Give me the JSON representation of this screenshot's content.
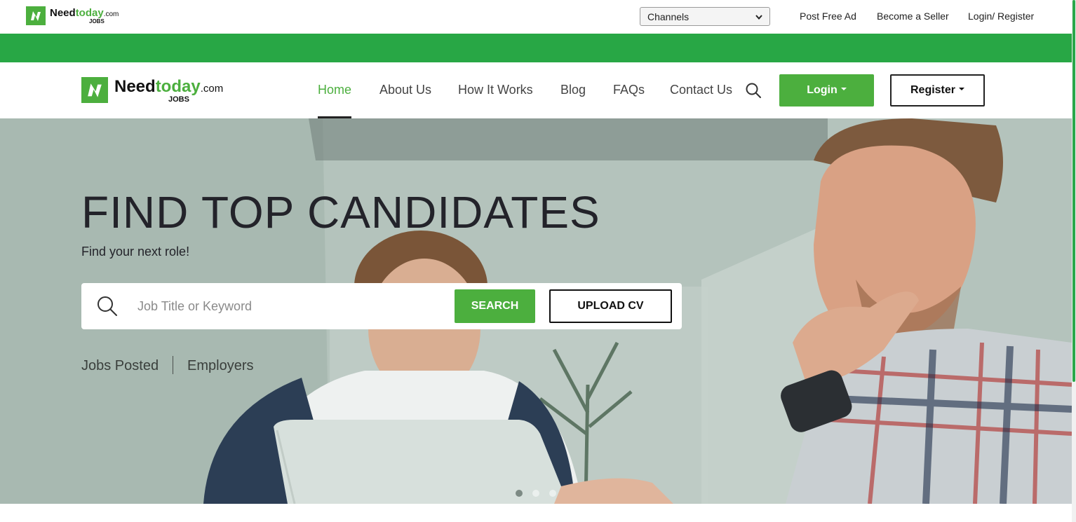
{
  "topbar": {
    "logo": {
      "need": "Need",
      "today": "today",
      "dotcom": ".com",
      "jobs": "JOBS"
    },
    "channels_select": {
      "value": "Channels",
      "icon": "chevron-down-icon"
    },
    "links": [
      "Post Free Ad",
      "Become a Seller",
      "Login/ Register"
    ]
  },
  "navbar": {
    "logo": {
      "need": "Need",
      "today": "today",
      "dotcom": ".com",
      "jobs": "JOBS"
    },
    "items": [
      {
        "label": "Home",
        "active": true
      },
      {
        "label": "About Us"
      },
      {
        "label": "How It Works"
      },
      {
        "label": "Blog"
      },
      {
        "label": "FAQs"
      },
      {
        "label": "Contact Us"
      }
    ],
    "search_icon": "search-icon",
    "login_label": "Login",
    "register_label": "Register"
  },
  "hero": {
    "title": "FIND TOP CANDIDATES",
    "subtitle": "Find your next role!",
    "search": {
      "placeholder": "Job Title or Keyword",
      "value": "",
      "search_label": "SEARCH",
      "upload_label": "UPLOAD CV"
    },
    "stats": [
      "Jobs Posted",
      "Employers"
    ],
    "carousel": {
      "count": 3,
      "active_index": 0
    }
  },
  "colors": {
    "brand_green": "#4caf3e",
    "bar_green": "#28a745",
    "text_dark": "#23232a"
  }
}
